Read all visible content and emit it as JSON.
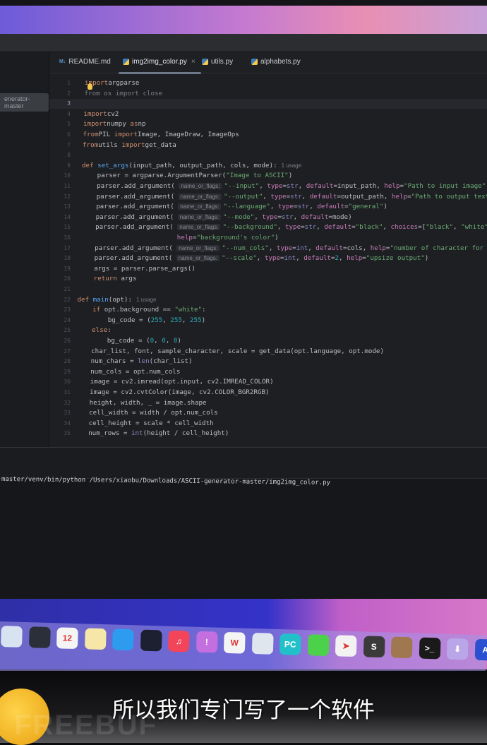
{
  "project": {
    "name": "enerator-master"
  },
  "tabs": [
    {
      "label": "README.md",
      "icon": "markdown-icon",
      "active": false
    },
    {
      "label": "img2img_color.py",
      "icon": "python-icon",
      "active": true
    },
    {
      "label": "utils.py",
      "icon": "python-icon",
      "active": false
    },
    {
      "label": "alphabets.py",
      "icon": "python-icon",
      "active": false
    }
  ],
  "code": [
    {
      "n": "1",
      "t": [
        [
          "kw",
          "import"
        ],
        [
          "",
          "argparse"
        ]
      ]
    },
    {
      "n": "2",
      "t": [
        [
          "cm",
          "from os import close"
        ]
      ]
    },
    {
      "n": "3",
      "cur": true,
      "t": []
    },
    {
      "n": "4",
      "t": [
        [
          "kw",
          "import"
        ],
        [
          "",
          "cv2"
        ]
      ]
    },
    {
      "n": "5",
      "t": [
        [
          "kw",
          "import"
        ],
        [
          "",
          "numpy "
        ],
        [
          "kw",
          "as"
        ],
        [
          "",
          "np"
        ]
      ]
    },
    {
      "n": "6",
      "t": [
        [
          "kw",
          "from"
        ],
        [
          "",
          "PIL "
        ],
        [
          "kw",
          "import"
        ],
        [
          "",
          "Image, ImageDraw, ImageOps"
        ]
      ]
    },
    {
      "n": "7",
      "t": [
        [
          "kw",
          "from"
        ],
        [
          "",
          "utils "
        ],
        [
          "kw",
          "import"
        ],
        [
          "",
          "get_data"
        ]
      ]
    },
    {
      "n": "8",
      "t": []
    },
    {
      "n": "9",
      "t": [
        [
          "kw",
          "def "
        ],
        [
          "fn",
          "set_args"
        ],
        [
          "",
          "(input_path, output_path, cols, mode):"
        ],
        [
          "usage",
          "1 usage"
        ]
      ]
    },
    {
      "n": "10",
      "t": [
        [
          "",
          "    parser = argparse.ArgumentParser("
        ],
        [
          "st",
          "\"Image to ASCII\""
        ],
        [
          "",
          ")"
        ]
      ]
    },
    {
      "n": "11",
      "t": [
        [
          "",
          "    parser.add_argument( "
        ],
        [
          "hint",
          "name_or_flags:"
        ],
        [
          "st",
          "\"--input\""
        ],
        [
          "",
          ", "
        ],
        [
          "kwa",
          "type"
        ],
        [
          "",
          "="
        ],
        [
          "bi",
          "str"
        ],
        [
          "",
          ", "
        ],
        [
          "kwa",
          "default"
        ],
        [
          "",
          "=input_path, "
        ],
        [
          "kwa",
          "help"
        ],
        [
          "",
          "="
        ],
        [
          "st",
          "\"Path to input image\""
        ],
        [
          "",
          ")"
        ]
      ]
    },
    {
      "n": "12",
      "t": [
        [
          "",
          "    parser.add_argument( "
        ],
        [
          "hint",
          "name_or_flags:"
        ],
        [
          "st",
          "\"--output\""
        ],
        [
          "",
          ", "
        ],
        [
          "kwa",
          "type"
        ],
        [
          "",
          "="
        ],
        [
          "bi",
          "str"
        ],
        [
          "",
          ", "
        ],
        [
          "kwa",
          "default"
        ],
        [
          "",
          "=output_path, "
        ],
        [
          "kwa",
          "help"
        ],
        [
          "",
          "="
        ],
        [
          "st",
          "\"Path to output text file"
        ]
      ]
    },
    {
      "n": "13",
      "t": [
        [
          "",
          "    parser.add_argument( "
        ],
        [
          "hint",
          "name_or_flags:"
        ],
        [
          "st",
          "\"--language\""
        ],
        [
          "",
          ", "
        ],
        [
          "kwa",
          "type"
        ],
        [
          "",
          "="
        ],
        [
          "bi",
          "str"
        ],
        [
          "",
          ", "
        ],
        [
          "kwa",
          "default"
        ],
        [
          "",
          "="
        ],
        [
          "st",
          "\"general\""
        ],
        [
          "",
          ")"
        ]
      ]
    },
    {
      "n": "14",
      "t": [
        [
          "",
          "    parser.add_argument( "
        ],
        [
          "hint",
          "name_or_flags:"
        ],
        [
          "st",
          "\"--mode\""
        ],
        [
          "",
          ", "
        ],
        [
          "kwa",
          "type"
        ],
        [
          "",
          "="
        ],
        [
          "bi",
          "str"
        ],
        [
          "",
          ", "
        ],
        [
          "kwa",
          "default"
        ],
        [
          "",
          "=mode)"
        ]
      ]
    },
    {
      "n": "15",
      "t": [
        [
          "",
          "    parser.add_argument( "
        ],
        [
          "hint",
          "name_or_flags:"
        ],
        [
          "st",
          "\"--background\""
        ],
        [
          "",
          ", "
        ],
        [
          "kwa",
          "type"
        ],
        [
          "",
          "="
        ],
        [
          "bi",
          "str"
        ],
        [
          "",
          ", "
        ],
        [
          "kwa",
          "default"
        ],
        [
          "",
          "="
        ],
        [
          "st",
          "\"black\""
        ],
        [
          "",
          ", "
        ],
        [
          "kwa",
          "choices"
        ],
        [
          "",
          "=["
        ],
        [
          "st",
          "\"black\""
        ],
        [
          "",
          ", "
        ],
        [
          "st",
          "\"white\""
        ],
        [
          "",
          "],"
        ]
      ]
    },
    {
      "n": "16",
      "t": [
        [
          "",
          "                         "
        ],
        [
          "kwa",
          "help"
        ],
        [
          "",
          "="
        ],
        [
          "st",
          "\"background's color\""
        ],
        [
          "",
          ")"
        ]
      ]
    },
    {
      "n": "17",
      "t": [
        [
          "",
          "    parser.add_argument( "
        ],
        [
          "hint",
          "name_or_flags:"
        ],
        [
          "st",
          "\"--num_cols\""
        ],
        [
          "",
          ", "
        ],
        [
          "kwa",
          "type"
        ],
        [
          "",
          "="
        ],
        [
          "bi",
          "int"
        ],
        [
          "",
          ", "
        ],
        [
          "kwa",
          "default"
        ],
        [
          "",
          "=cols, "
        ],
        [
          "kwa",
          "help"
        ],
        [
          "",
          "="
        ],
        [
          "st",
          "\"number of character for output"
        ]
      ]
    },
    {
      "n": "18",
      "t": [
        [
          "",
          "    parser.add_argument( "
        ],
        [
          "hint",
          "name_or_flags:"
        ],
        [
          "st",
          "\"--scale\""
        ],
        [
          "",
          ", "
        ],
        [
          "kwa",
          "type"
        ],
        [
          "",
          "="
        ],
        [
          "bi",
          "int"
        ],
        [
          "",
          ", "
        ],
        [
          "kwa",
          "default"
        ],
        [
          "",
          "="
        ],
        [
          "nu",
          "2"
        ],
        [
          "",
          ", "
        ],
        [
          "kwa",
          "help"
        ],
        [
          "",
          "="
        ],
        [
          "st",
          "\"upsize output\""
        ],
        [
          "",
          ")"
        ]
      ]
    },
    {
      "n": "19",
      "t": [
        [
          "",
          "    args = parser.parse_args()"
        ]
      ]
    },
    {
      "n": "20",
      "t": [
        [
          "kw",
          "    return "
        ],
        [
          "",
          "args"
        ]
      ]
    },
    {
      "n": "21",
      "t": []
    },
    {
      "n": "22",
      "t": [
        [
          "kw",
          "def "
        ],
        [
          "fn",
          "main"
        ],
        [
          "",
          "(opt):"
        ],
        [
          "usage",
          "1 usage"
        ]
      ]
    },
    {
      "n": "23",
      "t": [
        [
          "kw",
          "    if "
        ],
        [
          "",
          "opt.background == "
        ],
        [
          "st",
          "\"white\""
        ],
        [
          "",
          ":"
        ]
      ]
    },
    {
      "n": "24",
      "t": [
        [
          "",
          "        bg_code = ("
        ],
        [
          "nu",
          "255"
        ],
        [
          "",
          ", "
        ],
        [
          "nu",
          "255"
        ],
        [
          "",
          ", "
        ],
        [
          "nu",
          "255"
        ],
        [
          "",
          ")"
        ]
      ]
    },
    {
      "n": "25",
      "t": [
        [
          "kw",
          "    else"
        ],
        [
          "",
          ":"
        ]
      ]
    },
    {
      "n": "26",
      "t": [
        [
          "",
          "        bg_code = ("
        ],
        [
          "nu",
          "0"
        ],
        [
          "",
          ", "
        ],
        [
          "nu",
          "0"
        ],
        [
          "",
          ", "
        ],
        [
          "nu",
          "0"
        ],
        [
          "",
          ")"
        ]
      ]
    },
    {
      "n": "27",
      "t": [
        [
          "",
          "    char_list, font, sample_character, scale = get_data(opt.language, opt.mode)"
        ]
      ]
    },
    {
      "n": "28",
      "t": [
        [
          "",
          "    num_chars = "
        ],
        [
          "bi",
          "len"
        ],
        [
          "",
          "(char_list)"
        ]
      ]
    },
    {
      "n": "29",
      "t": [
        [
          "",
          "    num_cols = opt.num_cols"
        ]
      ]
    },
    {
      "n": "30",
      "t": [
        [
          "",
          "    image = cv2.imread(opt.input, cv2.IMREAD_COLOR)"
        ]
      ]
    },
    {
      "n": "31",
      "t": [
        [
          "",
          "    image = cv2.cvtColor(image, cv2.COLOR_BGR2RGB)"
        ]
      ]
    },
    {
      "n": "32",
      "t": [
        [
          "",
          "    height, width, _ = image.shape"
        ]
      ]
    },
    {
      "n": "33",
      "t": [
        [
          "",
          "    cell_width = width / opt.num_cols"
        ]
      ]
    },
    {
      "n": "34",
      "t": [
        [
          "",
          "    cell_height = scale * cell_width"
        ]
      ]
    },
    {
      "n": "35",
      "t": [
        [
          "",
          "    num_rows = "
        ],
        [
          "bi",
          "int"
        ],
        [
          "",
          "(height / cell_height)"
        ]
      ]
    }
  ],
  "terminal": {
    "command": "master/venv/bin/python /Users/xiaobu/Downloads/ASCII-generator-master/img2img_color.py"
  },
  "dock": [
    {
      "icon": "iphone-mirroring-icon",
      "color": "#d7e3f0"
    },
    {
      "icon": "davinci-resolve-icon",
      "color": "#2a2f3a"
    },
    {
      "icon": "calendar-icon",
      "color": "#f4f4f4",
      "label": "12"
    },
    {
      "icon": "notes-icon",
      "color": "#f6e7a8"
    },
    {
      "icon": "keynote-icon",
      "color": "#2d9cf0"
    },
    {
      "icon": "video-player-icon",
      "color": "#1c2030"
    },
    {
      "icon": "music-icon",
      "color": "#f2455a",
      "label": "♫"
    },
    {
      "icon": "feedback-icon",
      "color": "#c46fe0",
      "label": "!"
    },
    {
      "icon": "wps-office-icon",
      "color": "#f4f4f4",
      "label": "W"
    },
    {
      "icon": "preview-icon",
      "color": "#e0e6ee"
    },
    {
      "icon": "pycharm-icon",
      "color": "#22c0c8",
      "label": "PC"
    },
    {
      "icon": "green-app-icon",
      "color": "#4cd14a"
    },
    {
      "icon": "red-arrow-app-icon",
      "color": "#f2f2f2",
      "label": "➤"
    },
    {
      "icon": "sublime-text-icon",
      "color": "#3a3a3a",
      "label": "S"
    },
    {
      "icon": "squirrel-app-icon",
      "color": "#a07850"
    },
    {
      "icon": "terminal-icon",
      "color": "#1a1a1a",
      "label": ">_"
    },
    {
      "icon": "downloads-icon",
      "color": "#b9a6e8",
      "label": "⬇"
    },
    {
      "icon": "app-store-icon",
      "color": "#2a4fd0",
      "label": "A"
    }
  ],
  "subtitle": "所以我们专门写了一个软件",
  "watermark": "FREEBUF"
}
